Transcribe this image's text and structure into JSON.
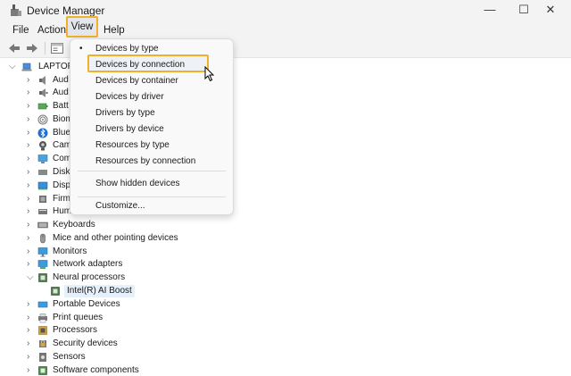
{
  "window": {
    "title": "Device Manager",
    "minimize": "—",
    "maximize": "☐",
    "close": "✕"
  },
  "menu": {
    "file": "File",
    "action": "Action",
    "view": "View",
    "help": "Help"
  },
  "view_menu": {
    "items": [
      {
        "label": "Devices by type",
        "checked": true
      },
      {
        "label": "Devices by connection",
        "checked": false
      },
      {
        "label": "Devices by container",
        "checked": false
      },
      {
        "label": "Devices by driver",
        "checked": false
      },
      {
        "label": "Drivers by type",
        "checked": false
      },
      {
        "label": "Drivers by device",
        "checked": false
      },
      {
        "label": "Resources by type",
        "checked": false
      },
      {
        "label": "Resources by connection",
        "checked": false
      }
    ],
    "show_hidden": "Show hidden devices",
    "customize": "Customize...",
    "check_glyph": "•"
  },
  "tree": {
    "root": "LAPTOP",
    "categories": [
      {
        "label": "Aud",
        "icon": "speaker-icon"
      },
      {
        "label": "Aud",
        "icon": "audio-input-icon"
      },
      {
        "label": "Batt",
        "icon": "battery-icon"
      },
      {
        "label": "Biom",
        "icon": "fingerprint-icon"
      },
      {
        "label": "Blue",
        "icon": "bluetooth-icon"
      },
      {
        "label": "Cam",
        "icon": "camera-icon"
      },
      {
        "label": "Com",
        "icon": "computer-icon"
      },
      {
        "label": "Disk",
        "icon": "disk-icon"
      },
      {
        "label": "Disp",
        "icon": "display-adapter-icon"
      },
      {
        "label": "Firm",
        "icon": "firmware-icon"
      },
      {
        "label": "Hum",
        "icon": "hid-icon"
      },
      {
        "label": "Keyboards",
        "icon": "keyboard-icon"
      },
      {
        "label": "Mice and other pointing devices",
        "icon": "mouse-icon"
      },
      {
        "label": "Monitors",
        "icon": "monitor-icon"
      },
      {
        "label": "Network adapters",
        "icon": "network-adapter-icon"
      },
      {
        "label": "Neural processors",
        "icon": "neural-processor-icon",
        "expanded": true
      },
      {
        "label": "Intel(R) AI Boost",
        "icon": "npu-device-icon",
        "child": true
      },
      {
        "label": "Portable Devices",
        "icon": "portable-device-icon"
      },
      {
        "label": "Print queues",
        "icon": "printer-icon"
      },
      {
        "label": "Processors",
        "icon": "processor-icon"
      },
      {
        "label": "Security devices",
        "icon": "security-device-icon"
      },
      {
        "label": "Sensors",
        "icon": "sensor-icon"
      },
      {
        "label": "Software components",
        "icon": "software-component-icon"
      }
    ]
  }
}
